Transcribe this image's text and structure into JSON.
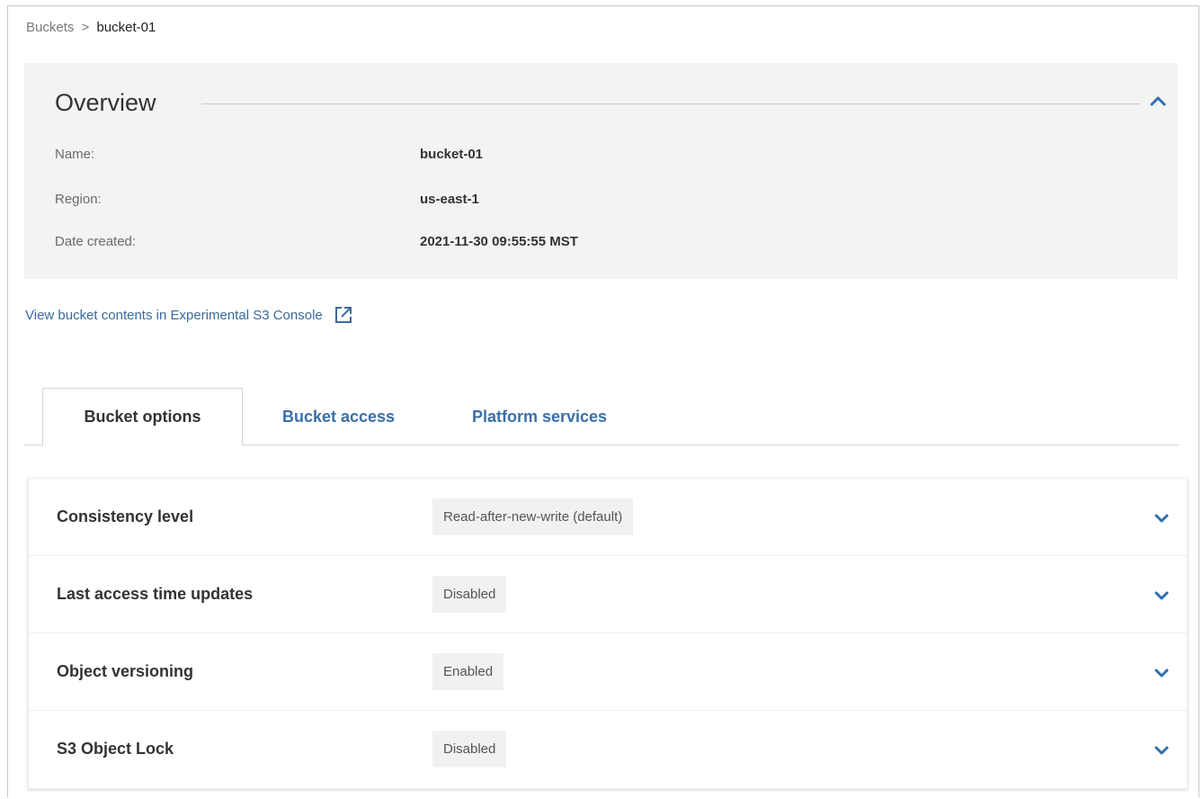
{
  "breadcrumb": {
    "parent": "Buckets",
    "separator": ">",
    "current": "bucket-01"
  },
  "overview": {
    "title": "Overview",
    "rows": [
      {
        "label": "Name:",
        "value": "bucket-01"
      },
      {
        "label": "Region:",
        "value": "us-east-1"
      },
      {
        "label": "Date created:",
        "value": "2021-11-30 09:55:55 MST"
      }
    ]
  },
  "console_link": {
    "text": "View bucket contents in Experimental S3 Console",
    "icon": "external-link-icon"
  },
  "tabs": [
    {
      "label": "Bucket options",
      "active": true
    },
    {
      "label": "Bucket access",
      "active": false
    },
    {
      "label": "Platform services",
      "active": false
    }
  ],
  "options": [
    {
      "label": "Consistency level",
      "value": "Read-after-new-write (default)"
    },
    {
      "label": "Last access time updates",
      "value": "Disabled"
    },
    {
      "label": "Object versioning",
      "value": "Enabled"
    },
    {
      "label": "S3 Object Lock",
      "value": "Disabled"
    }
  ],
  "colors": {
    "link": "#3a6fa8",
    "panel_bg": "#f3f3f3",
    "badge_bg": "#f1f1f1",
    "chevron": "#2d6fb0"
  }
}
